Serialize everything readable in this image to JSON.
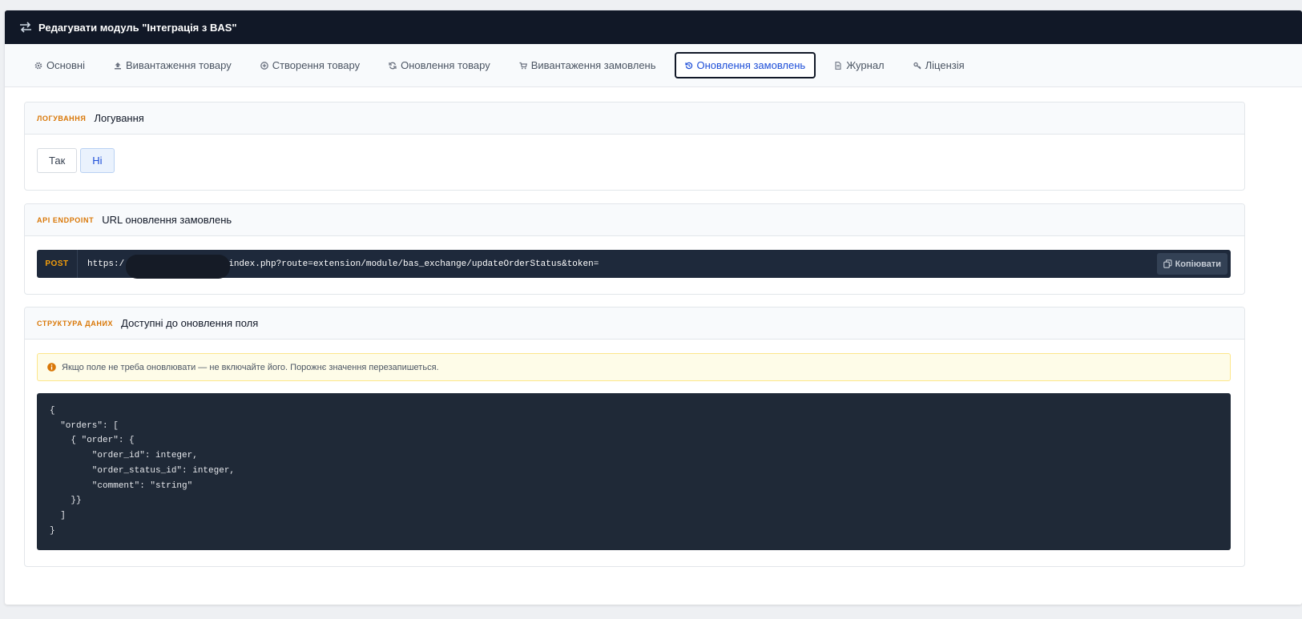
{
  "header": {
    "title": "Редагувати модуль \"Інтеграція з BAS\"",
    "icon": "exchange-icon"
  },
  "tabs": [
    {
      "label": "Основні",
      "icon": "gear-icon"
    },
    {
      "label": "Вивантаження товару",
      "icon": "upload-icon"
    },
    {
      "label": "Створення товару",
      "icon": "plus-circle-icon"
    },
    {
      "label": "Оновлення товару",
      "icon": "refresh-icon"
    },
    {
      "label": "Вивантаження замовлень",
      "icon": "cart-icon"
    },
    {
      "label": "Оновлення замовлень",
      "icon": "history-icon",
      "active": true
    },
    {
      "label": "Журнал",
      "icon": "document-icon"
    },
    {
      "label": "Ліцензія",
      "icon": "key-icon"
    }
  ],
  "logging": {
    "tag": "Логування",
    "title": "Логування",
    "options": [
      "Так",
      "Ні"
    ],
    "selected": "Ні"
  },
  "endpoint": {
    "tag": "API Endpoint",
    "title": "URL оновлення замовлень",
    "method": "POST",
    "url_prefix": "https:/",
    "url_suffix": "index.php?route=extension/module/bas_exchange/updateOrderStatus&token=",
    "copy_label": "Копіювати"
  },
  "structure": {
    "tag": "Структура даних",
    "title": "Доступні до оновлення поля",
    "notice": "Якщо поле не треба оновлювати — не включайте його. Порожнє значення перезапишеться.",
    "code": "{\n  \"orders\": [\n    { \"order\": {\n        \"order_id\": integer,\n        \"order_status_id\": integer,\n        \"comment\": \"string\"\n    }}\n  ]\n}"
  },
  "colors": {
    "header_bg": "#111827",
    "accent_tag": "#d97706",
    "active_tab": "#1d4ed8",
    "code_bg": "#1f2937",
    "method": "#f59e0b"
  }
}
